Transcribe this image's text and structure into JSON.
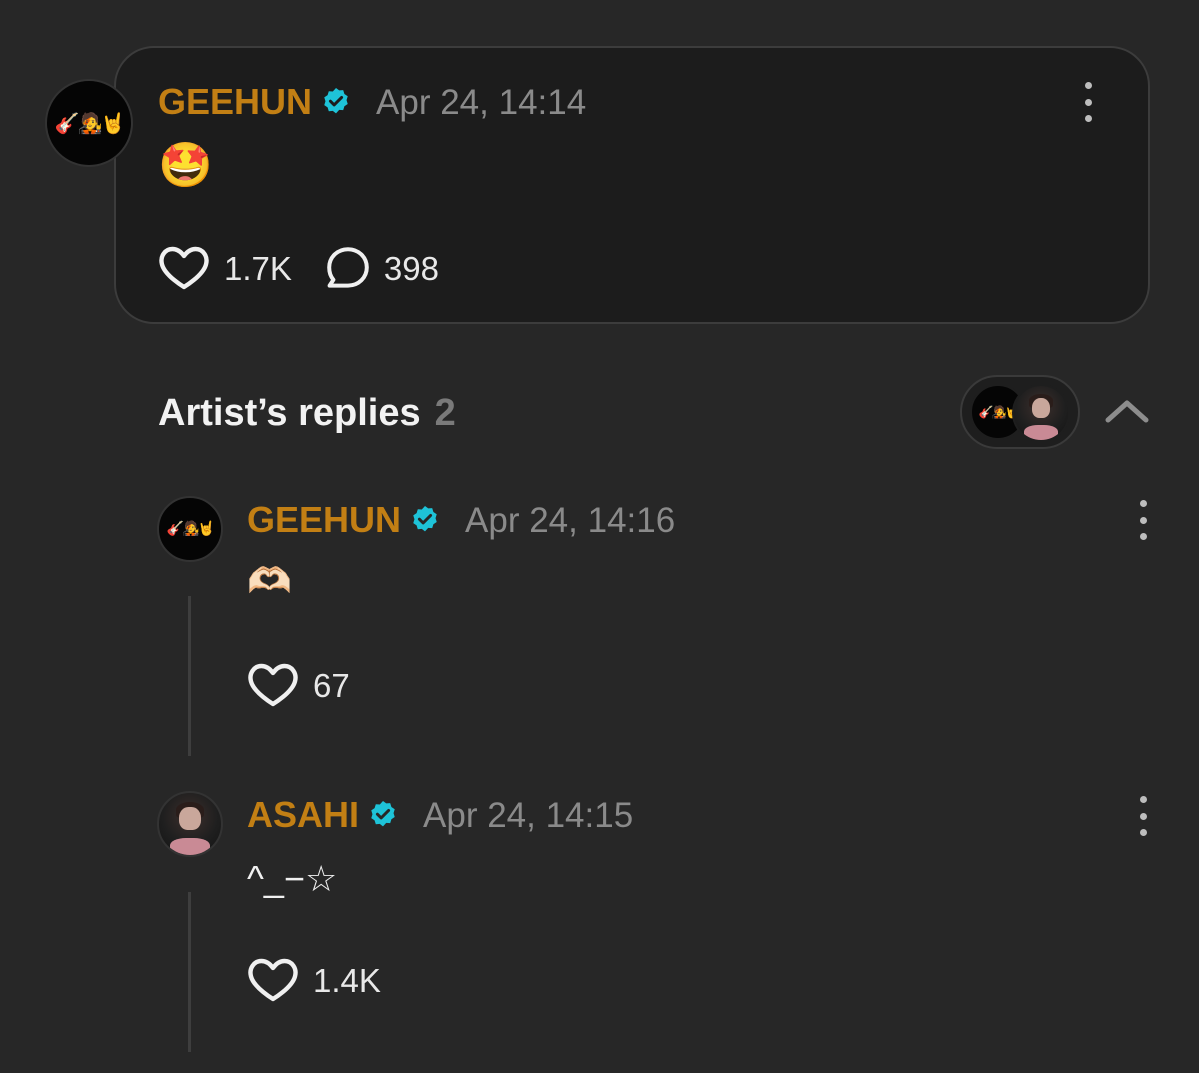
{
  "post": {
    "author": "GEEHUN",
    "avatar_emoji": "🎸🧑‍🎤🤘",
    "timestamp": "Apr 24, 14:14",
    "content": "🤩",
    "likes": "1.7K",
    "comments": "398",
    "verified": true
  },
  "replies_section": {
    "title": "Artist’s replies",
    "count": "2"
  },
  "replies": [
    {
      "author": "GEEHUN",
      "avatar_emoji": "🎸🧑‍🎤🤘",
      "timestamp": "Apr 24, 14:16",
      "content": "🫶🏻",
      "likes": "67",
      "verified": true
    },
    {
      "author": "ASAHI",
      "timestamp": "Apr 24, 14:15",
      "content": "^_−☆",
      "likes": "1.4K",
      "verified": true
    }
  ],
  "colors": {
    "background": "#272727",
    "card": "#1c1c1c",
    "author_name": "#c27f14",
    "verified_badge": "#1ec3d8",
    "timestamp": "#8a8a8a"
  },
  "icons": [
    "heart-icon",
    "comment-bubble-icon",
    "verified-badge-icon",
    "more-options-icon",
    "chevron-up-icon"
  ]
}
